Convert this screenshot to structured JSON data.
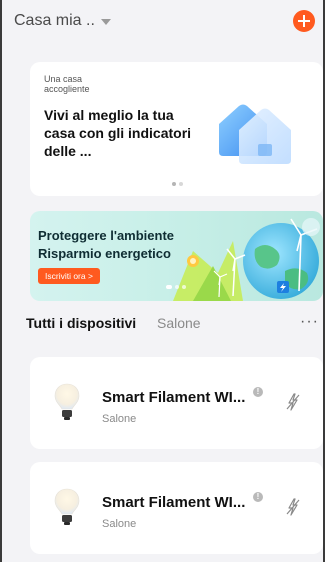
{
  "header": {
    "home_name": "Casa mia ..",
    "add_icon": "plus-icon"
  },
  "info_card": {
    "small_text": "Una casa accogliente",
    "title": "Vivi al meglio la tua casa con gli indicatori delle ...",
    "art_icon": "house-icon"
  },
  "banner": {
    "line1": "Proteggere l'ambiente",
    "line2": "Risparmio energetico",
    "button_label": "Iscriviti ora >"
  },
  "tabs": {
    "all": "Tutti i dispositivi",
    "room": "Salone",
    "more": "···"
  },
  "devices": [
    {
      "name": "Smart Filament WI...",
      "room": "Salone",
      "icon": "bulb-icon",
      "status_icon": "offline-icon",
      "action_icon": "power-off-icon"
    },
    {
      "name": "Smart Filament WI...",
      "room": "Salone",
      "icon": "bulb-icon",
      "status_icon": "offline-icon",
      "action_icon": "power-off-icon"
    }
  ],
  "colors": {
    "accent": "#ff5a1f",
    "background": "#f3f3f6"
  }
}
